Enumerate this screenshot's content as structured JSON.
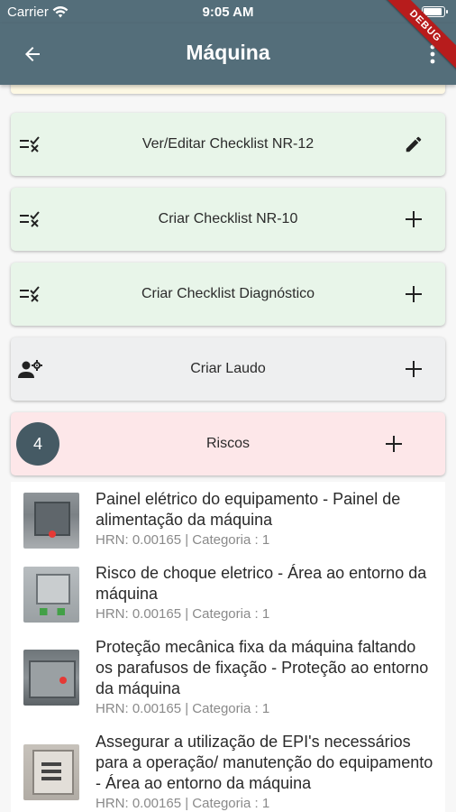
{
  "status_bar": {
    "carrier": "Carrier",
    "time": "9:05 AM"
  },
  "app_bar": {
    "title": "Máquina",
    "debug_label": "DEBUG"
  },
  "actions": [
    {
      "label": "Ver/Editar Checklist NR-12",
      "icon": "checklist-icon",
      "trailing_icon": "edit-icon",
      "color": "#e8f5e9"
    },
    {
      "label": "Criar Checklist NR-10",
      "icon": "checklist-icon",
      "trailing_icon": "add-icon",
      "color": "#e8f5e9"
    },
    {
      "label": "Criar Checklist Diagnóstico",
      "icon": "checklist-icon",
      "trailing_icon": "add-icon",
      "color": "#e8f5e9"
    },
    {
      "label": "Criar Laudo",
      "icon": "person-gear-icon",
      "trailing_icon": "add-icon",
      "color": "#eeeff0"
    }
  ],
  "risks_header": {
    "label": "Riscos",
    "count": "4",
    "color": "#fde7e9"
  },
  "risks": [
    {
      "title": "Painel elétrico do equipamento - Painel de alimentação da máquina",
      "subtitle": "HRN: 0.00165 | Categoria : 1"
    },
    {
      "title": "Risco de choque eletrico - Área ao entorno da máquina",
      "subtitle": "HRN: 0.00165 | Categoria : 1"
    },
    {
      "title": "Proteção mecânica fixa da máquina faltando os parafusos de fixação - Proteção ao entorno da máquina",
      "subtitle": "HRN: 0.00165 | Categoria : 1"
    },
    {
      "title": "Assegurar a utilização de EPI's necessários para a operação/ manutenção do equipamento - Área ao entorno da máquina",
      "subtitle": "HRN: 0.00165 | Categoria : 1"
    }
  ]
}
